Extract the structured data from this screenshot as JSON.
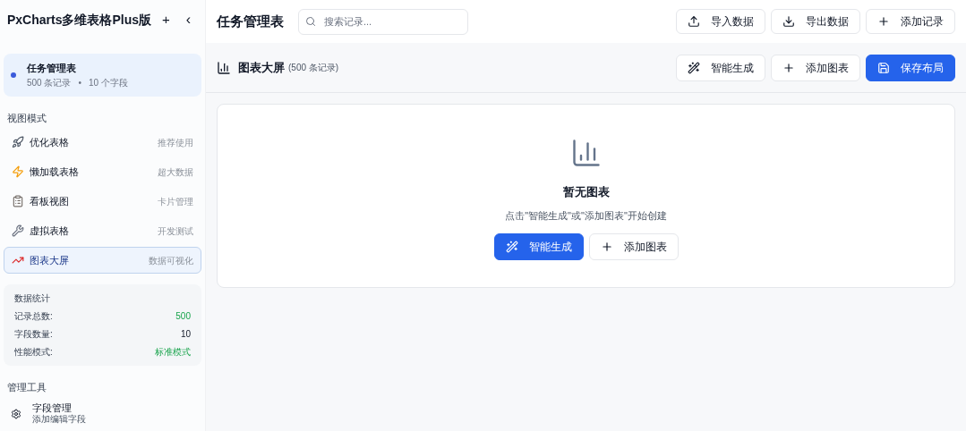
{
  "sidebar": {
    "app_title": "PxCharts多维表格Plus版",
    "add_symbol": "+",
    "collapse_symbol": "‹",
    "table": {
      "name": "任务管理表",
      "records": "500 条记录",
      "separator": "•",
      "fields": "10 个字段",
      "selected": true
    },
    "view_section": "视图模式",
    "views": [
      {
        "kind": "rocket",
        "label": "优化表格",
        "hint": "推荐使用",
        "selected": false
      },
      {
        "kind": "bolt",
        "label": "懒加载表格",
        "hint": "超大数据",
        "selected": false
      },
      {
        "kind": "board",
        "label": "看板视图",
        "hint": "卡片管理",
        "selected": false
      },
      {
        "kind": "wrench",
        "label": "虚拟表格",
        "hint": "开发测试",
        "selected": false
      },
      {
        "kind": "chart",
        "label": "图表大屏",
        "hint": "数据可视化",
        "selected": true
      }
    ],
    "stats": {
      "title": "数据统计",
      "rows": [
        {
          "label": "记录总数:",
          "value": "500",
          "kind": "positive"
        },
        {
          "label": "字段数量:",
          "value": "10",
          "kind": "neutral"
        },
        {
          "label": "性能模式:",
          "value": "标准模式",
          "kind": "positive"
        }
      ]
    },
    "tools_section": "管理工具",
    "tools": [
      {
        "label": "字段管理",
        "hint": "添加编辑字段"
      }
    ]
  },
  "header": {
    "title": "任务管理表",
    "search": {
      "placeholder": "搜索记录..."
    },
    "buttons": [
      {
        "kind": "upload",
        "label": "导入数据"
      },
      {
        "kind": "download",
        "label": "导出数据"
      },
      {
        "kind": "plus",
        "label": "添加记录"
      }
    ]
  },
  "dashboard": {
    "title": "图表大屏",
    "count": "(500 条记录)",
    "buttons": [
      {
        "kind": "wand",
        "label": "智能生成",
        "primary": false
      },
      {
        "kind": "plus",
        "label": "添加图表",
        "primary": false
      },
      {
        "kind": "save",
        "label": "保存布局",
        "primary": true
      }
    ],
    "empty": {
      "title": "暂无图表",
      "message": "点击\"智能生成\"或\"添加图表\"开始创建",
      "buttons": [
        {
          "kind": "wand",
          "label": "智能生成",
          "primary": true
        },
        {
          "kind": "plus",
          "label": "添加图表",
          "primary": false
        }
      ]
    }
  }
}
